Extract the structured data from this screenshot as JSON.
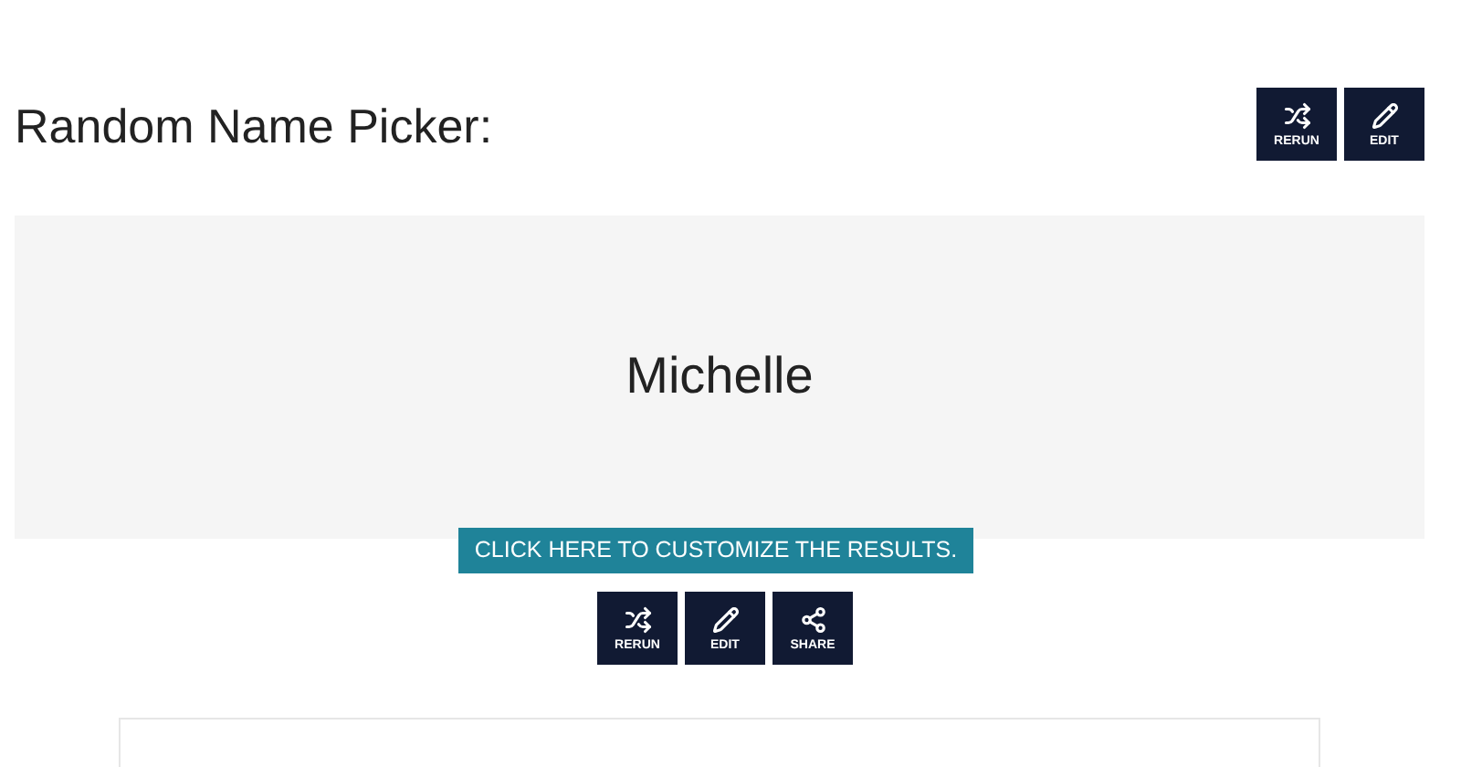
{
  "title": "Random Name Picker:",
  "top_actions": [
    {
      "kind": "shuffle",
      "label": "RERUN"
    },
    {
      "kind": "edit",
      "label": "EDIT"
    }
  ],
  "result": "Michelle",
  "customize_button": "CLICK HERE TO CUSTOMIZE THE RESULTS.",
  "bottom_actions": [
    {
      "kind": "shuffle",
      "label": "RERUN"
    },
    {
      "kind": "edit",
      "label": "EDIT"
    },
    {
      "kind": "share",
      "label": "SHARE"
    }
  ]
}
